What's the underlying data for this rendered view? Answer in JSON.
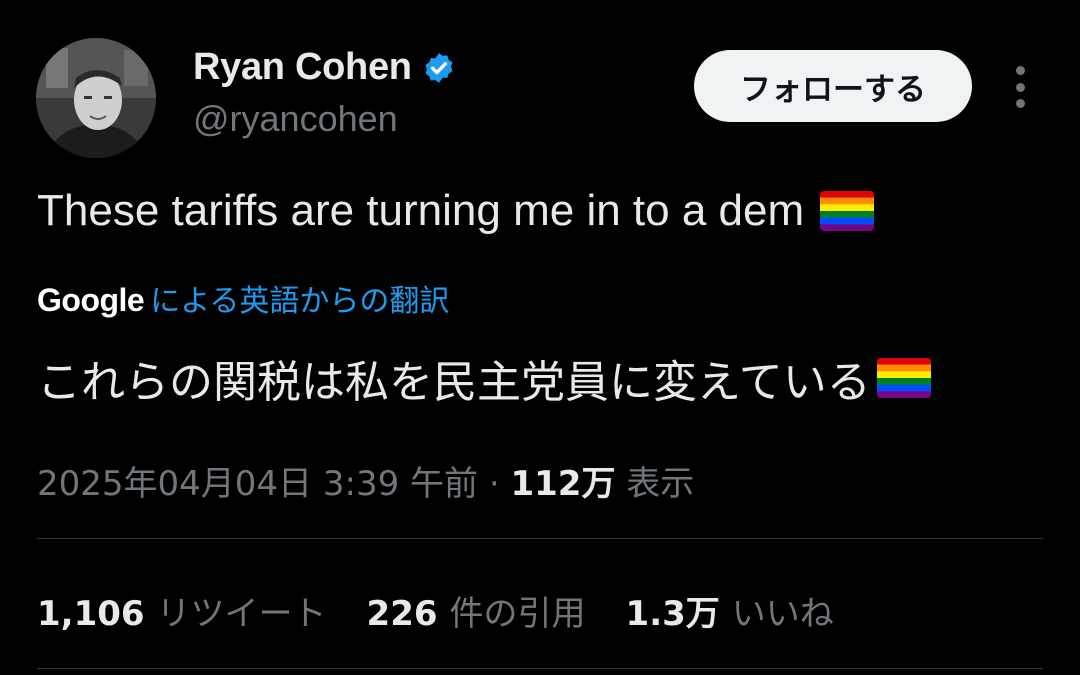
{
  "author": {
    "name": "Ryan Cohen",
    "handle": "@ryancohen",
    "verified_color": "#1d9bf0"
  },
  "follow_label": "フォローする",
  "tweet": {
    "text": "These tariffs are turning me in to a dem",
    "emoji": "rainbow-flag"
  },
  "translation": {
    "provider": "Google",
    "label": "による英語からの翻訳",
    "text": "これらの関税は私を民主党員に変えている"
  },
  "meta": {
    "timestamp": "2025年04月04日 3:39 午前",
    "separator": "·",
    "views_count": "112万",
    "views_label": "表示"
  },
  "stats": {
    "retweets_count": "1,106",
    "retweets_label": "リツイート",
    "quotes_count": "226",
    "quotes_label": "件の引用",
    "likes_count": "1.3万",
    "likes_label": "いいね"
  }
}
